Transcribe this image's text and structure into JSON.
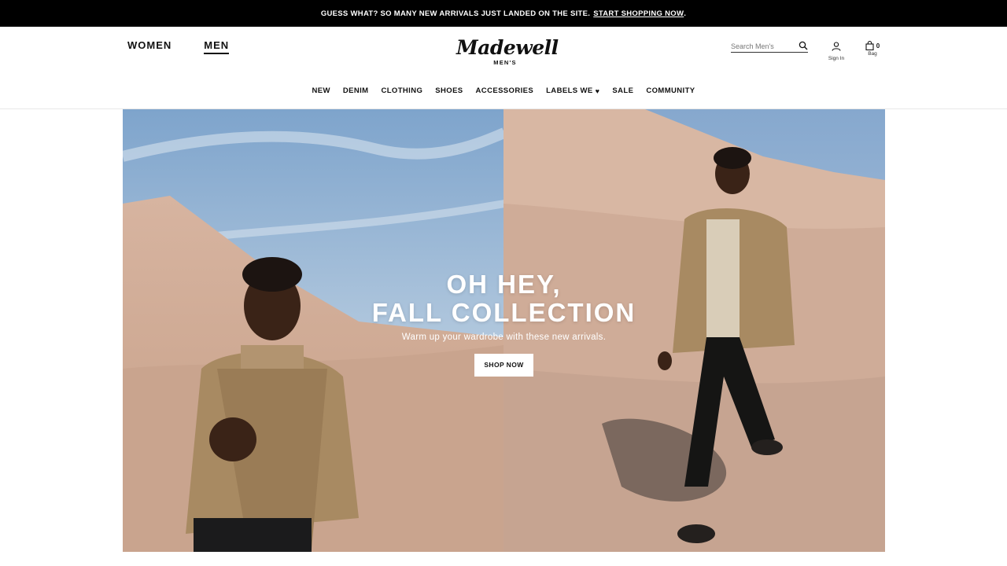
{
  "promo": {
    "text": "GUESS WHAT? SO MANY NEW ARRIVALS JUST LANDED ON THE SITE.",
    "link": "START SHOPPING NOW",
    "end": "."
  },
  "header": {
    "gender_tabs": [
      {
        "label": "WOMEN",
        "active": false
      },
      {
        "label": "MEN",
        "active": true
      }
    ],
    "logo": {
      "script": "Madewell",
      "sub": "MEN'S"
    },
    "search": {
      "placeholder": "Search Men's",
      "icon": "search-icon"
    },
    "account": {
      "label": "Sign In",
      "icon": "user-icon"
    },
    "bag": {
      "label": "Bag",
      "count": "0",
      "icon": "bag-icon"
    }
  },
  "nav": {
    "items": [
      "NEW",
      "DENIM",
      "CLOTHING",
      "SHOES",
      "ACCESSORIES",
      "LABELS WE",
      "SALE",
      "COMMUNITY"
    ],
    "heart_icon": "heart-icon"
  },
  "hero": {
    "title_line1": "OH HEY,",
    "title_line2": "FALL COLLECTION",
    "subtitle": "Warm up your wardrobe with these new arrivals.",
    "cta": "SHOP NOW"
  },
  "colors": {
    "promo_bg": "#000000",
    "sand": "#c9a48e",
    "sky": "#8fb0d2",
    "jacket": "#a88a62"
  }
}
